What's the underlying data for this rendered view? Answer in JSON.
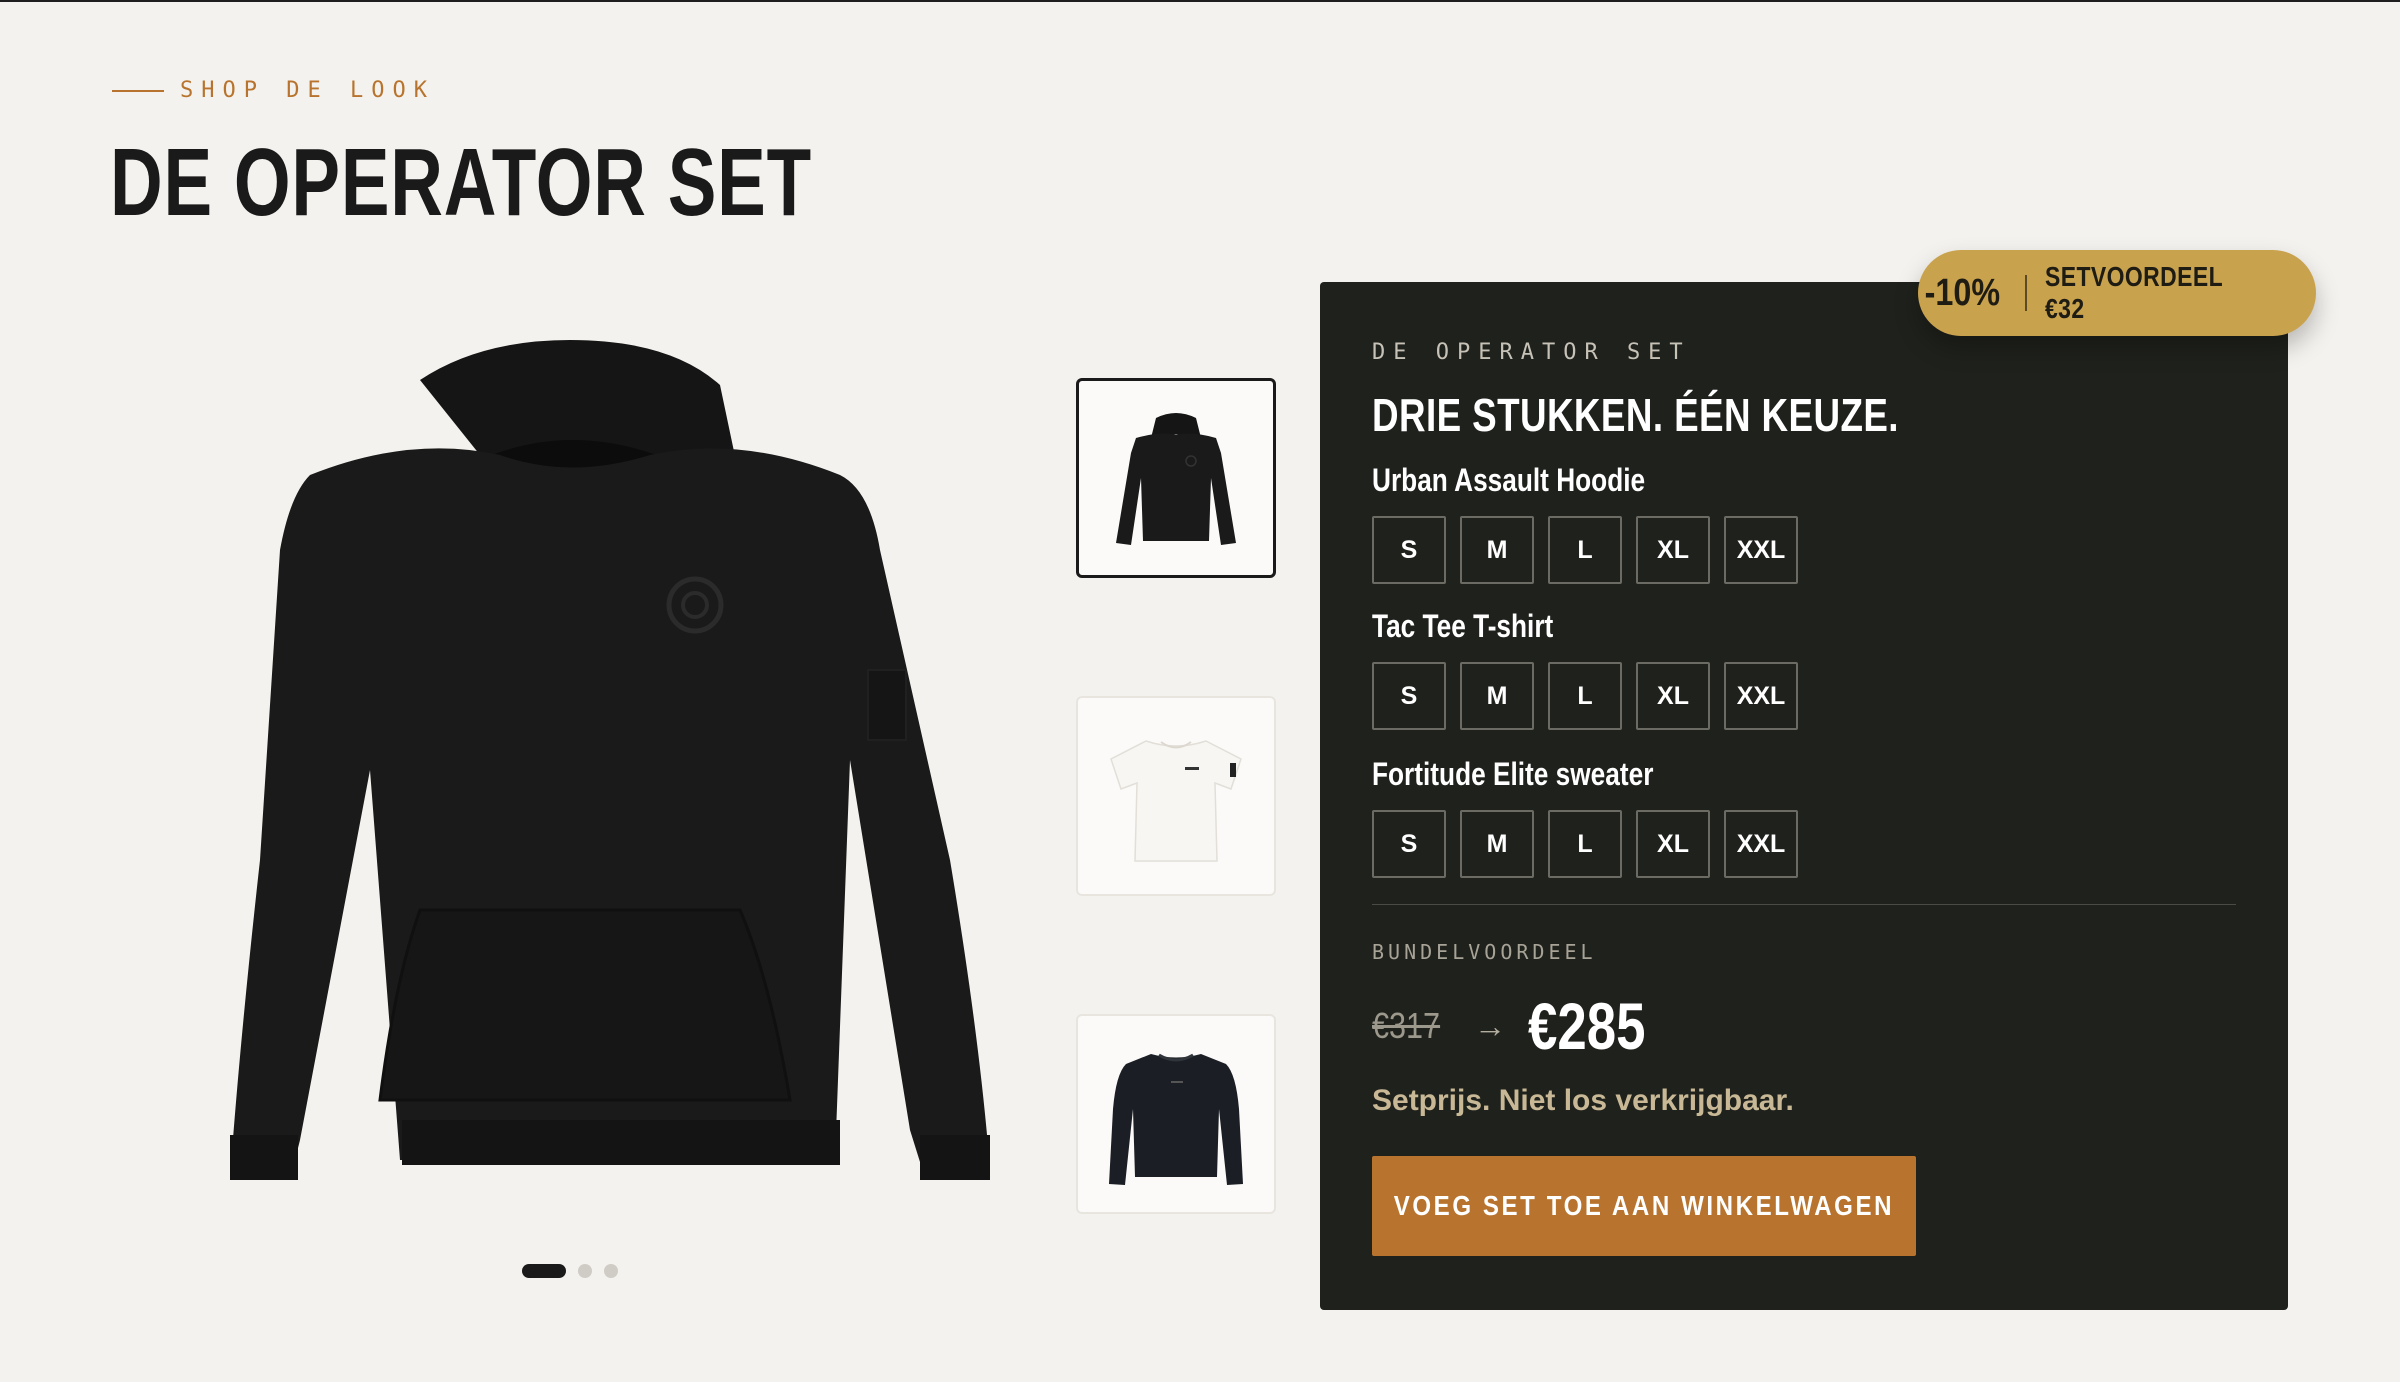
{
  "header": {
    "eyebrow": "SHOP DE LOOK",
    "title": "DE OPERATOR SET"
  },
  "gallery": {
    "thumbnails": [
      {
        "icon": "hoodie-thumbnail",
        "selected": true
      },
      {
        "icon": "tshirt-thumbnail",
        "selected": false
      },
      {
        "icon": "sweater-thumbnail",
        "selected": false
      }
    ],
    "pagination": {
      "total": 3,
      "active": 1
    }
  },
  "badge": {
    "discount": "-10%",
    "label": "SETVOORDEEL €32"
  },
  "panel": {
    "eyebrow": "DE OPERATOR SET",
    "title": "DRIE STUKKEN. ÉÉN KEUZE.",
    "products": [
      {
        "name": "Urban Assault Hoodie",
        "sizes": [
          "S",
          "M",
          "L",
          "XL",
          "XXL"
        ]
      },
      {
        "name": "Tac Tee T-shirt",
        "sizes": [
          "S",
          "M",
          "L",
          "XL",
          "XXL"
        ]
      },
      {
        "name": "Fortitude Elite sweater",
        "sizes": [
          "S",
          "M",
          "L",
          "XL",
          "XXL"
        ]
      }
    ],
    "bundle_label": "BUNDELVOORDEEL",
    "old_price": "€317",
    "arrow": "→",
    "new_price": "€285",
    "note": "Setprijs. Niet los verkrijgbaar.",
    "cta": "VOEG SET TOE AAN WINKELWAGEN"
  },
  "colors": {
    "background": "#f4f2ee",
    "accent": "#b8742e",
    "panel": "#1f211c",
    "badge": "#c9a24e"
  }
}
